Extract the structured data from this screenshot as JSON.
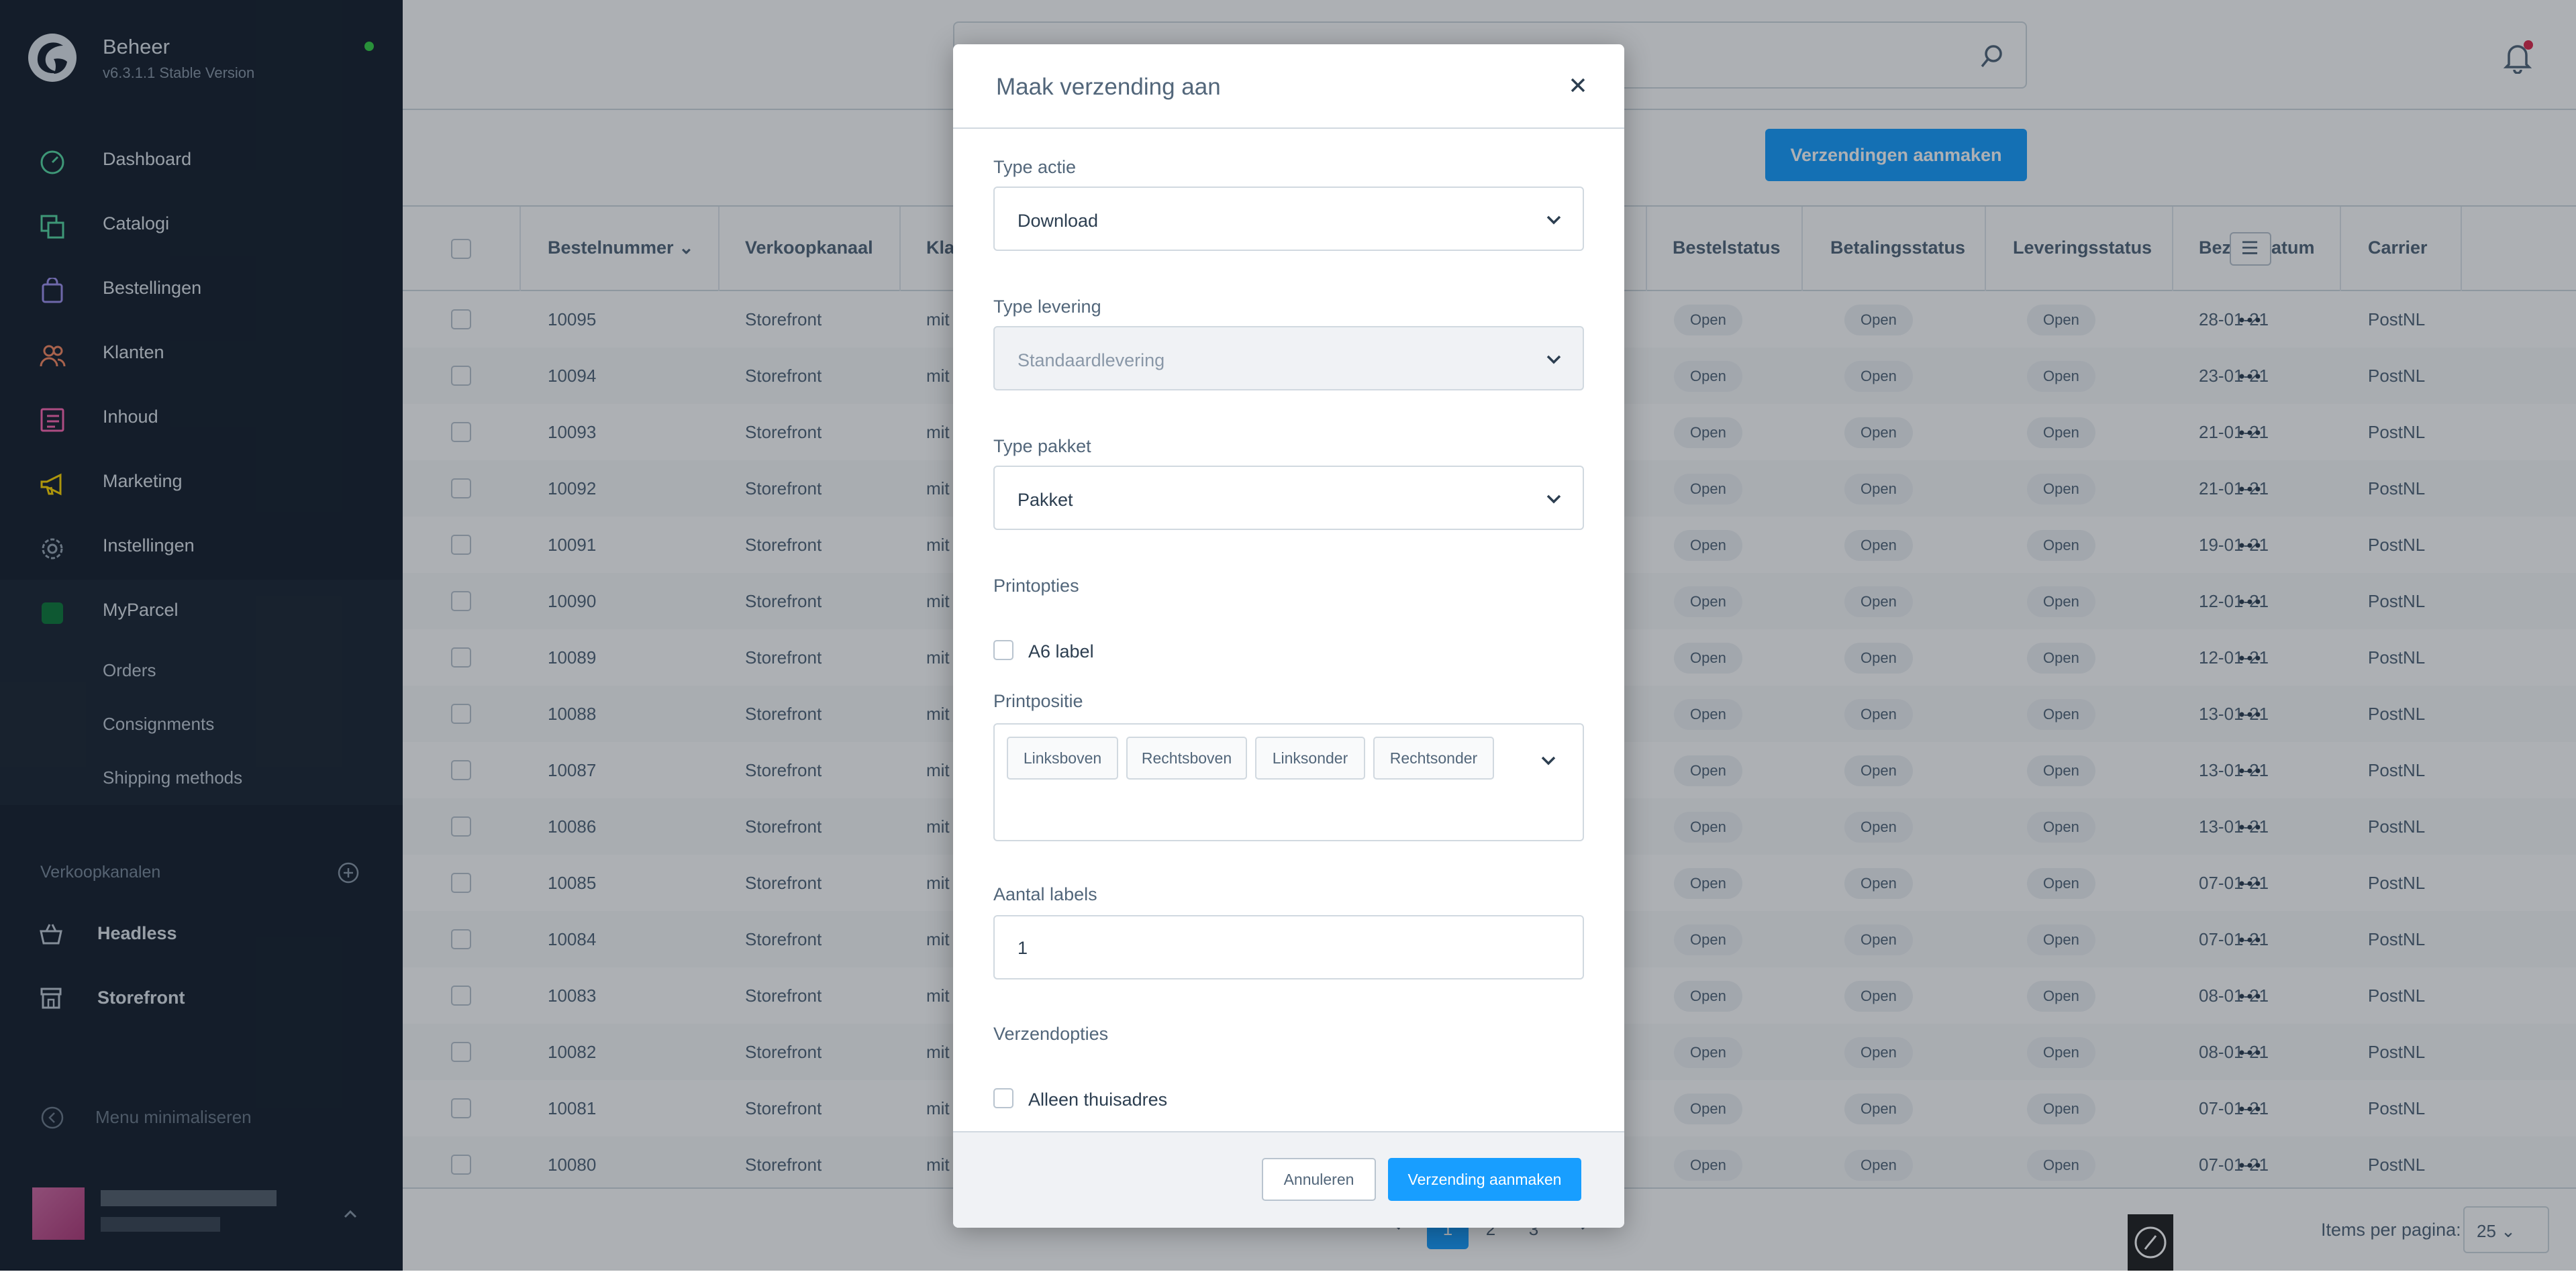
{
  "app": {
    "title": "Beheer",
    "version": "v6.3.1.1 Stable Version",
    "status_color": "#37d046"
  },
  "sidebar": {
    "items": [
      {
        "label": "Dashboard",
        "icon": "gauge-icon",
        "color": "#57d9a3"
      },
      {
        "label": "Catalogi",
        "icon": "catalog-icon",
        "color": "#57d9a3"
      },
      {
        "label": "Bestellingen",
        "icon": "shopping-bag-icon",
        "color": "#a092f0"
      },
      {
        "label": "Klanten",
        "icon": "users-icon",
        "color": "#f88962"
      },
      {
        "label": "Inhoud",
        "icon": "content-icon",
        "color": "#ff68b4"
      },
      {
        "label": "Marketing",
        "icon": "megaphone-icon",
        "color": "#ffd700"
      },
      {
        "label": "Instellingen",
        "icon": "gear-icon",
        "color": "#9aa8b5"
      },
      {
        "label": "MyParcel",
        "icon": "myparcel-icon",
        "color": "#0f7a3b"
      }
    ],
    "sub_items": [
      "Orders",
      "Consignments",
      "Shipping methods"
    ],
    "sales_channels_title": "Verkoopkanalen",
    "channels": [
      {
        "label": "Headless",
        "icon": "basket-icon"
      },
      {
        "label": "Storefront",
        "icon": "storefront-icon"
      }
    ],
    "collapse_label": "Menu minimaliseren"
  },
  "toolbar": {
    "create_shipments_label": "Verzendingen aanmaken"
  },
  "grid": {
    "columns": [
      "Bestelnummer",
      "Verkoopkanaal",
      "Kla",
      "Bestelstatus",
      "Betalingsstatus",
      "Leveringsstatus",
      "Bezorgdatum",
      "Carrier"
    ],
    "rows": [
      {
        "number": "10095",
        "channel": "Storefront",
        "customer": "mit",
        "order_status": "Open",
        "payment_status": "Open",
        "delivery_status": "Open",
        "date": "28-01-21",
        "carrier": "PostNL"
      },
      {
        "number": "10094",
        "channel": "Storefront",
        "customer": "mit",
        "order_status": "Open",
        "payment_status": "Open",
        "delivery_status": "Open",
        "date": "23-01-21",
        "carrier": "PostNL"
      },
      {
        "number": "10093",
        "channel": "Storefront",
        "customer": "mit",
        "order_status": "Open",
        "payment_status": "Open",
        "delivery_status": "Open",
        "date": "21-01-21",
        "carrier": "PostNL"
      },
      {
        "number": "10092",
        "channel": "Storefront",
        "customer": "mit",
        "order_status": "Open",
        "payment_status": "Open",
        "delivery_status": "Open",
        "date": "21-01-21",
        "carrier": "PostNL"
      },
      {
        "number": "10091",
        "channel": "Storefront",
        "customer": "mit",
        "order_status": "Open",
        "payment_status": "Open",
        "delivery_status": "Open",
        "date": "19-01-21",
        "carrier": "PostNL"
      },
      {
        "number": "10090",
        "channel": "Storefront",
        "customer": "mit",
        "order_status": "Open",
        "payment_status": "Open",
        "delivery_status": "Open",
        "date": "12-01-21",
        "carrier": "PostNL"
      },
      {
        "number": "10089",
        "channel": "Storefront",
        "customer": "mit",
        "order_status": "Open",
        "payment_status": "Open",
        "delivery_status": "Open",
        "date": "12-01-21",
        "carrier": "PostNL"
      },
      {
        "number": "10088",
        "channel": "Storefront",
        "customer": "mit",
        "order_status": "Open",
        "payment_status": "Open",
        "delivery_status": "Open",
        "date": "13-01-21",
        "carrier": "PostNL"
      },
      {
        "number": "10087",
        "channel": "Storefront",
        "customer": "mit",
        "order_status": "Open",
        "payment_status": "Open",
        "delivery_status": "Open",
        "date": "13-01-21",
        "carrier": "PostNL"
      },
      {
        "number": "10086",
        "channel": "Storefront",
        "customer": "mit",
        "order_status": "Open",
        "payment_status": "Open",
        "delivery_status": "Open",
        "date": "13-01-21",
        "carrier": "PostNL"
      },
      {
        "number": "10085",
        "channel": "Storefront",
        "customer": "mit",
        "order_status": "Open",
        "payment_status": "Open",
        "delivery_status": "Open",
        "date": "07-01-21",
        "carrier": "PostNL"
      },
      {
        "number": "10084",
        "channel": "Storefront",
        "customer": "mit",
        "order_status": "Open",
        "payment_status": "Open",
        "delivery_status": "Open",
        "date": "07-01-21",
        "carrier": "PostNL"
      },
      {
        "number": "10083",
        "channel": "Storefront",
        "customer": "mit",
        "order_status": "Open",
        "payment_status": "Open",
        "delivery_status": "Open",
        "date": "08-01-21",
        "carrier": "PostNL"
      },
      {
        "number": "10082",
        "channel": "Storefront",
        "customer": "mit",
        "order_status": "Open",
        "payment_status": "Open",
        "delivery_status": "Open",
        "date": "08-01-21",
        "carrier": "PostNL"
      },
      {
        "number": "10081",
        "channel": "Storefront",
        "customer": "mit",
        "order_status": "Open",
        "payment_status": "Open",
        "delivery_status": "Open",
        "date": "07-01-21",
        "carrier": "PostNL"
      },
      {
        "number": "10080",
        "channel": "Storefront",
        "customer": "mit",
        "order_status": "Open",
        "payment_status": "Open",
        "delivery_status": "Open",
        "date": "07-01-21",
        "carrier": "PostNL"
      }
    ]
  },
  "pagination": {
    "pages": [
      "1",
      "2",
      "3"
    ],
    "active_page": "1",
    "items_per_page_label": "Items per pagina:",
    "items_per_page_value": "25"
  },
  "modal": {
    "title": "Maak verzending aan",
    "action_type_label": "Type actie",
    "action_type_value": "Download",
    "delivery_type_label": "Type levering",
    "delivery_type_value": "Standaardlevering",
    "package_type_label": "Type pakket",
    "package_type_value": "Pakket",
    "print_options_title": "Printopties",
    "a6_label": "A6 label",
    "print_position_label": "Printpositie",
    "print_positions": [
      "Linksboven",
      "Rechtsboven",
      "Linksonder",
      "Rechtsonder"
    ],
    "label_count_label": "Aantal labels",
    "label_count_value": "1",
    "shipping_options_title": "Verzendopties",
    "home_address_only_label": "Alleen thuisadres",
    "cancel_label": "Annuleren",
    "submit_label": "Verzending aanmaken"
  },
  "colors": {
    "primary": "#189eff",
    "sidebar_bg": "#17212e",
    "notification": "#de294c"
  }
}
